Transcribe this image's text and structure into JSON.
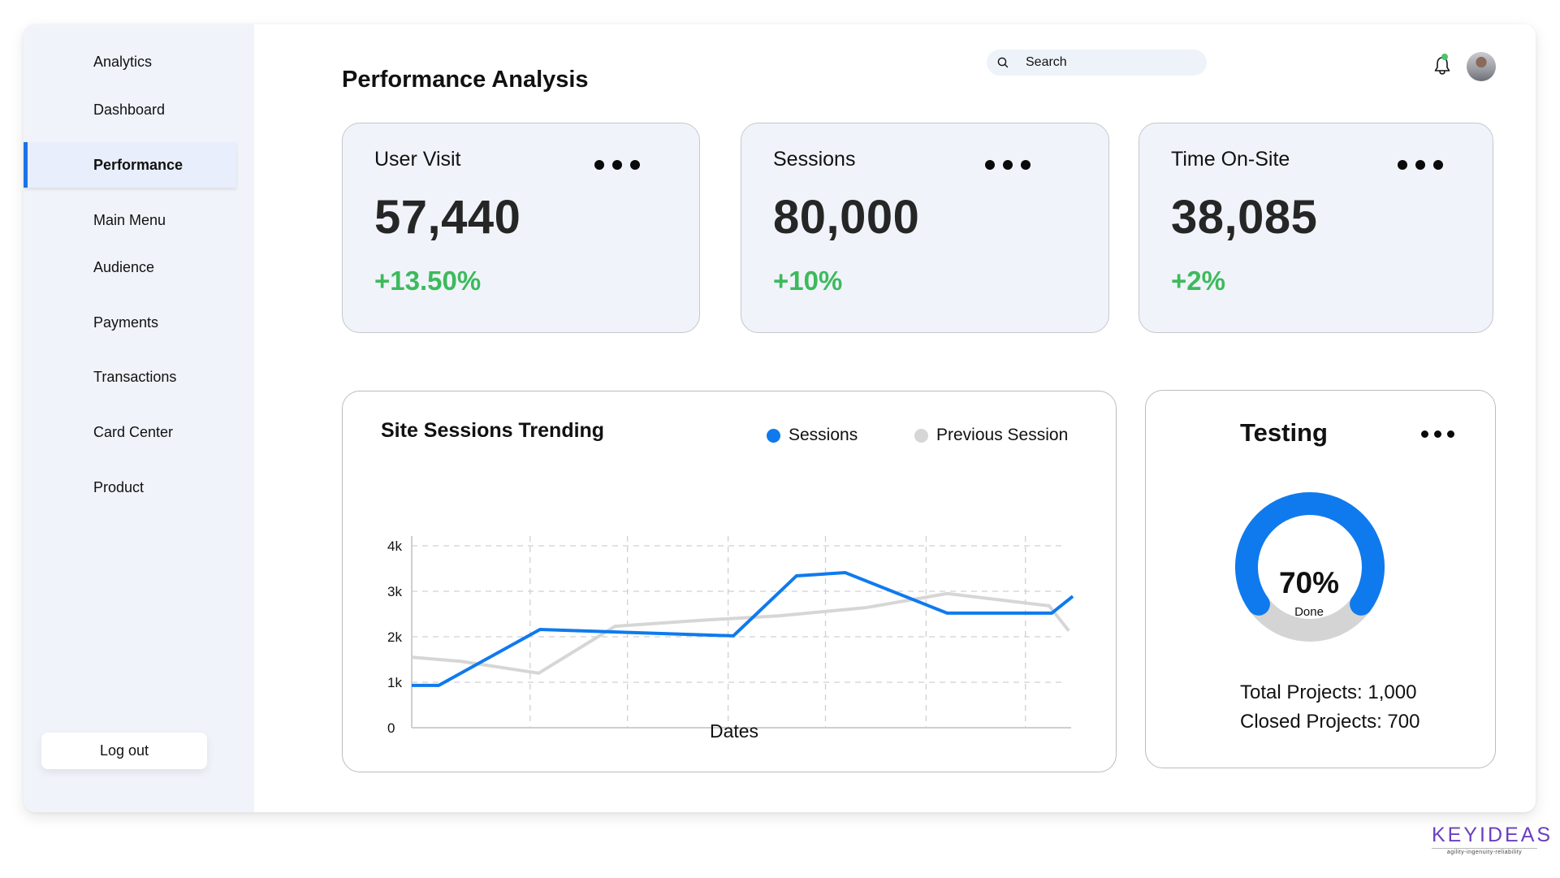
{
  "sidebar": {
    "items": [
      {
        "label": "Analytics",
        "active": false
      },
      {
        "label": "Dashboard",
        "active": false
      },
      {
        "label": "Performance",
        "active": true
      },
      {
        "label": "Main Menu",
        "active": false
      },
      {
        "label": "Audience",
        "active": false
      },
      {
        "label": "Payments",
        "active": false
      },
      {
        "label": "Transactions",
        "active": false
      },
      {
        "label": "Card Center",
        "active": false
      },
      {
        "label": "Product",
        "active": false
      }
    ],
    "logout_label": "Log out"
  },
  "header": {
    "title": "Performance Analysis",
    "search_placeholder": "Search",
    "search_icon": "search-icon",
    "notification_icon": "bell-icon",
    "notification_badge_color": "#4cc46a",
    "avatar": "user-avatar"
  },
  "stats": [
    {
      "label": "User Visit",
      "value": "57,440",
      "change": "+13.50%"
    },
    {
      "label": "Sessions",
      "value": "80,000",
      "change": "+10%"
    },
    {
      "label": "Time On-Site",
      "value": "38,085",
      "change": "+2%"
    }
  ],
  "colors": {
    "accent": "#0f7aed",
    "positive": "#3dba5c",
    "previous": "#d6d6d6",
    "brand": "#6b3fc0"
  },
  "chart_data": {
    "type": "line",
    "title": "Site Sessions Trending",
    "xlabel": "Dates",
    "ylabel": "",
    "ylim": [
      0,
      4000
    ],
    "xlim": [
      0,
      100
    ],
    "yticks": [
      0,
      1000,
      2000,
      3000,
      4000
    ],
    "ytick_labels": [
      "0",
      "1k",
      "2k",
      "3k",
      "4k"
    ],
    "x_gridlines": [
      18,
      32.8,
      48.1,
      62.9,
      78.2,
      93.3
    ],
    "grid": true,
    "legend_position": "top-right",
    "series": [
      {
        "name": "Sessions",
        "color": "#0f7aed",
        "x": [
          0,
          4.1,
          19.5,
          48.9,
          58.5,
          65.9,
          81.4,
          97.3,
          100.5
        ],
        "y": [
          930,
          930,
          2160,
          2020,
          3340,
          3410,
          2520,
          2520,
          2890
        ]
      },
      {
        "name": "Previous Session",
        "color": "#d6d6d6",
        "x": [
          0,
          7.5,
          19.3,
          30.9,
          43.7,
          55.8,
          69.0,
          81.4,
          96.9,
          99.9
        ],
        "y": [
          1550,
          1460,
          1200,
          2230,
          2360,
          2460,
          2640,
          2950,
          2680,
          2130
        ]
      }
    ]
  },
  "testing": {
    "title": "Testing",
    "progress_percent": 70,
    "progress_label": "70%",
    "progress_sub": "Done",
    "total_projects": "Total Projects: 1,000",
    "closed_projects": "Closed Projects: 700"
  },
  "brand": {
    "name": "KEYIDEAS",
    "tagline": "agility-ingenuity-reliability"
  }
}
